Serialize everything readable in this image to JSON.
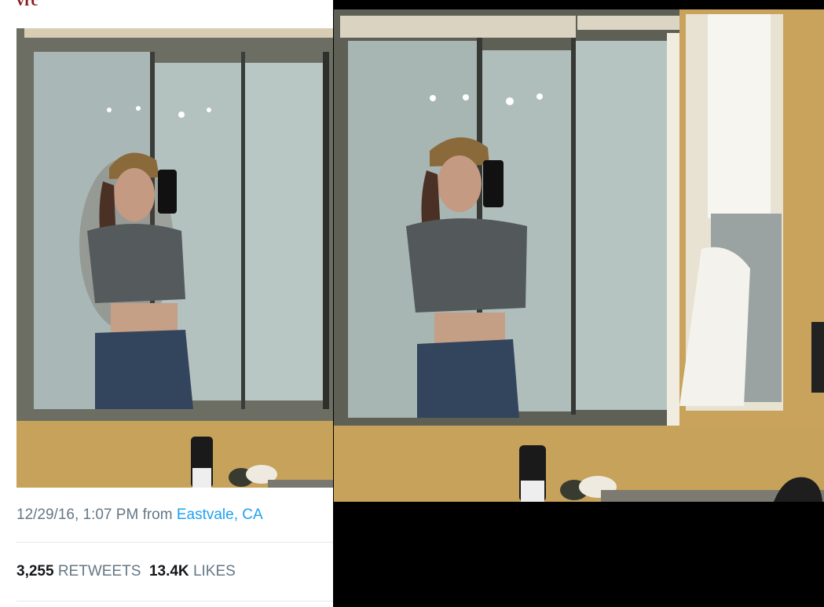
{
  "app": {
    "avatar_fragment": "vrc"
  },
  "tweet": {
    "timestamp": "12/29/16, 1:07 PM",
    "from_label": "from",
    "location": "Eastvale, CA",
    "retweets_count": "3,255",
    "retweets_label": "RETWEETS",
    "likes_count": "13.4K",
    "likes_label": "LIKES"
  },
  "colors": {
    "text_secondary": "#657786",
    "text_primary": "#14171a",
    "link": "#1da1f2",
    "divider": "#e1e8ed",
    "wall": "#c9a35c",
    "mirror_glass": "#a7b7b4"
  },
  "icons": [
    "photo-selfie-tweet",
    "photo-selfie-full"
  ]
}
